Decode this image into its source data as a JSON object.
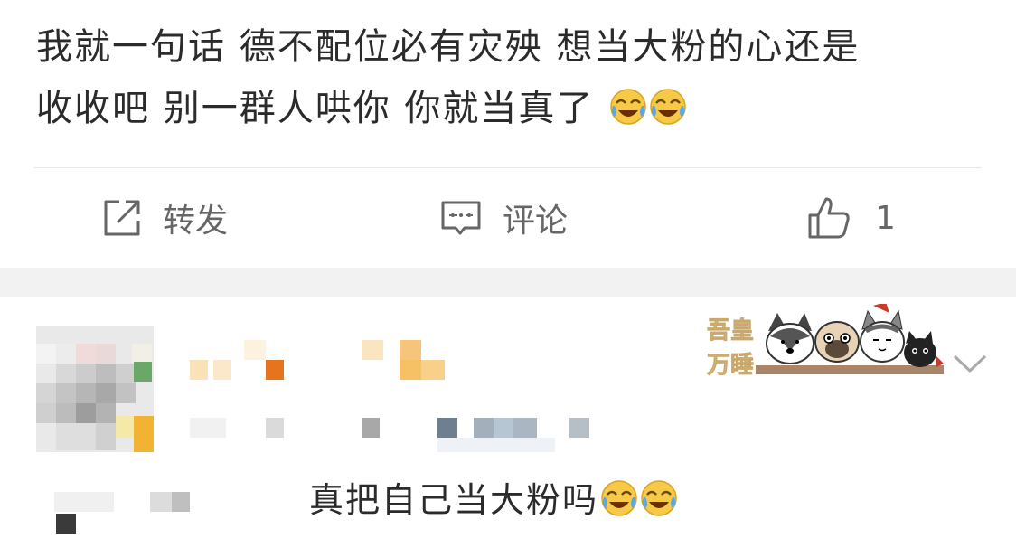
{
  "post": {
    "text_line1": "我就一句话 德不配位必有灾殃 想当大粉的心还是",
    "text_line2": "收收吧 别一群人哄你 你就当真了",
    "trailing_emoji": [
      "laugh-cry-icon",
      "laugh-cry-icon"
    ]
  },
  "actions": {
    "repost_label": "转发",
    "comment_label": "评论",
    "like_count": "1"
  },
  "comment": {
    "text": "真把自己当大粉吗",
    "trailing_emoji": [
      "laugh-cry-icon",
      "laugh-cry-icon"
    ],
    "sticker_text": "吾皇万睡"
  },
  "colors": {
    "text": "#2b2b2b",
    "action_gray": "#666666",
    "divider": "#e6e6e6",
    "band": "#f2f2f2",
    "emoji_yellow": "#f7c948",
    "tear_blue": "#5aa9e6"
  }
}
